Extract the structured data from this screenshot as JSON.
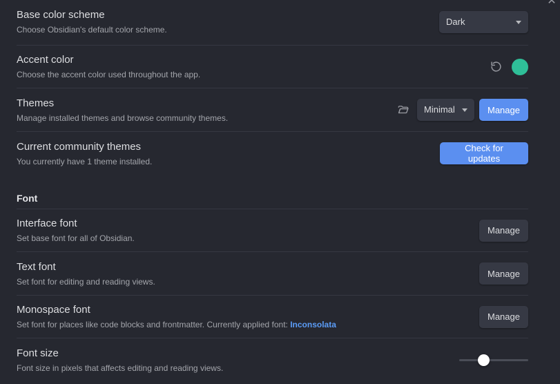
{
  "close_icon": "close-icon",
  "settings": {
    "base_color_scheme": {
      "name": "Base color scheme",
      "desc": "Choose Obsidian's default color scheme.",
      "value": "Dark"
    },
    "accent_color": {
      "name": "Accent color",
      "desc": "Choose the accent color used throughout the app.",
      "color": "#2fbf98",
      "reset_icon": "reset-icon"
    },
    "themes": {
      "name": "Themes",
      "desc": "Manage installed themes and browse community themes.",
      "value": "Minimal",
      "manage_label": "Manage",
      "folder_icon": "folder-icon"
    },
    "community_themes": {
      "name": "Current community themes",
      "desc": "You currently have 1 theme installed.",
      "button_label": "Check for updates"
    }
  },
  "font_section": {
    "heading": "Font",
    "interface_font": {
      "name": "Interface font",
      "desc": "Set base font for all of Obsidian.",
      "manage_label": "Manage"
    },
    "text_font": {
      "name": "Text font",
      "desc": "Set font for editing and reading views.",
      "manage_label": "Manage"
    },
    "monospace_font": {
      "name": "Monospace font",
      "desc_prefix": "Set font for places like code blocks and frontmatter. Currently applied font: ",
      "desc_link": "Inconsolata",
      "manage_label": "Manage"
    },
    "font_size": {
      "name": "Font size",
      "desc": "Font size in pixels that affects editing and reading views.",
      "slider_fraction": 0.35
    }
  },
  "colors": {
    "accent": "#5b8ff0",
    "background": "#262830",
    "link": "#5b9cf6"
  }
}
